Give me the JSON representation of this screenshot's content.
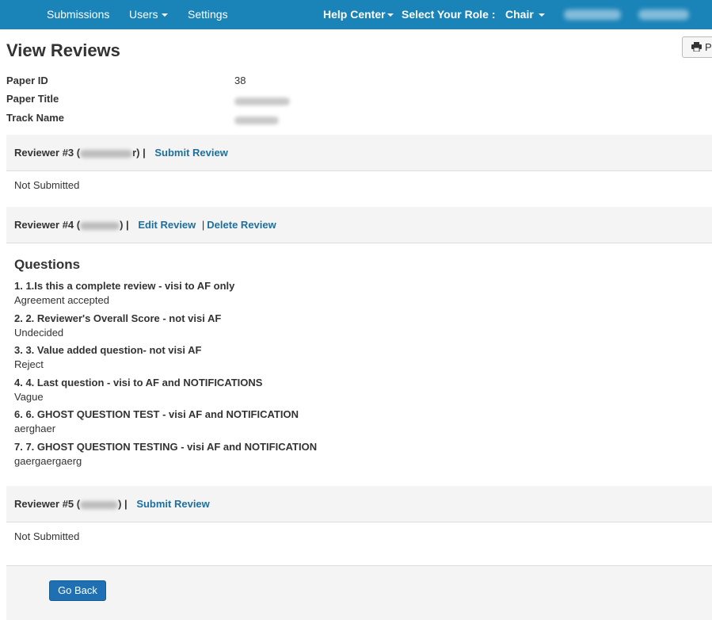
{
  "nav": {
    "submissions": "Submissions",
    "users": "Users",
    "settings": "Settings",
    "help_center": "Help Center",
    "select_role_label": "Select Your Role :",
    "role": "Chair"
  },
  "header": {
    "title": "View Reviews",
    "print_label": "P"
  },
  "info": {
    "paper_id_label": "Paper ID",
    "paper_id_value": "38",
    "paper_title_label": "Paper Title",
    "track_name_label": "Track Name"
  },
  "reviews": [
    {
      "reviewer_prefix": "Reviewer #3 (",
      "reviewer_suffix": "r) |",
      "action": "Submit Review",
      "status": "Not Submitted"
    },
    {
      "reviewer_prefix": "Reviewer #4 (",
      "reviewer_suffix": ") |",
      "edit_action": "Edit Review",
      "delete_sep": "|",
      "delete_action": "Delete Review"
    },
    {
      "reviewer_prefix": "Reviewer #5 (",
      "reviewer_suffix": ") |",
      "action": "Submit Review",
      "status": "Not Submitted"
    }
  ],
  "questions": {
    "title": "Questions",
    "items": [
      {
        "question": "1. 1.Is this a complete review - visi to AF only",
        "answer": "Agreement accepted"
      },
      {
        "question": "2. 2. Reviewer's Overall Score - not visi AF",
        "answer": "Undecided"
      },
      {
        "question": "3. 3. Value added question- not visi AF",
        "answer": "Reject"
      },
      {
        "question": "4. 4. Last question - visi to AF and NOTIFICATIONS",
        "answer": "Vague"
      },
      {
        "question": "6. 6. GHOST QUESTION TEST - visi AF and NOTIFICATION",
        "answer": "aerghaer"
      },
      {
        "question": "7. 7. GHOST QUESTION TESTING - visi AF and NOTIFICATION",
        "answer": "gaergaergaerg"
      }
    ]
  },
  "footer": {
    "go_back": "Go Back"
  },
  "colors": {
    "navbar": "#1a84b8",
    "link": "#1e6f9e",
    "button": "#1f6fb3"
  }
}
